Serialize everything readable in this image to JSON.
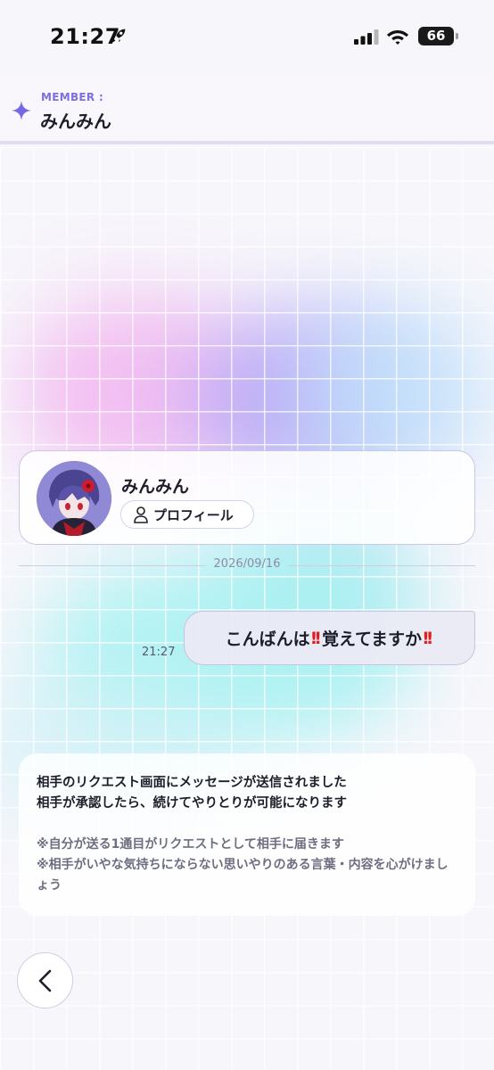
{
  "status_bar": {
    "time": "21:27",
    "battery": "66"
  },
  "header": {
    "label": "MEMBER :",
    "name": "みんみん"
  },
  "profile_card": {
    "name": "みんみん",
    "profile_button_label": "プロフィール"
  },
  "chat": {
    "date": "2026/09/16",
    "messages": [
      {
        "time": "21:27",
        "text_1": "こんばんは",
        "text_2": "覚えてますか"
      }
    ]
  },
  "notice": {
    "line_1": "相手のリクエスト画面にメッセージが送信されました",
    "line_2": "相手が承認したら、続けてやりとりが可能になります",
    "note_1": "※自分が送る1通目がリクエストとして相手に届きます",
    "note_2": "※相手がいやな気持ちにならない思いやりのある言葉・内容を心がけましょう"
  },
  "colors": {
    "accent": "#7c6fe0",
    "emphasis_mark": "#e0201f"
  },
  "icons": [
    "rocket-icon",
    "signal-icon",
    "wifi-icon",
    "sparkle-icon",
    "person-icon",
    "chevron-left-icon",
    "double-exclamation-icon"
  ]
}
